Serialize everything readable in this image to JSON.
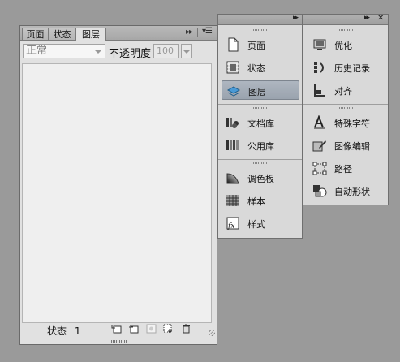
{
  "layers_panel": {
    "tabs": [
      {
        "label": "页面"
      },
      {
        "label": "状态"
      },
      {
        "label": "图层"
      }
    ],
    "menu_icon": "panel-menu-icon",
    "blend_mode": "正常",
    "opacity_label": "不透明度",
    "opacity_value": "100",
    "status_label": "状态",
    "status_count": "1"
  },
  "dock": {
    "left_column": {
      "group1": [
        {
          "label": "页面",
          "icon": "page-icon"
        },
        {
          "label": "状态",
          "icon": "states-icon"
        },
        {
          "label": "图层",
          "icon": "layers-icon"
        }
      ],
      "group2": [
        {
          "label": "文档库",
          "icon": "document-library-icon"
        },
        {
          "label": "公用库",
          "icon": "common-library-icon"
        }
      ],
      "group3": [
        {
          "label": "调色板",
          "icon": "color-palette-icon"
        },
        {
          "label": "样本",
          "icon": "swatches-icon"
        },
        {
          "label": "样式",
          "icon": "styles-icon"
        }
      ]
    },
    "right_column": {
      "group1": [
        {
          "label": "优化",
          "icon": "optimize-icon"
        },
        {
          "label": "历史记录",
          "icon": "history-icon"
        },
        {
          "label": "对齐",
          "icon": "align-icon"
        }
      ],
      "group2": [
        {
          "label": "特殊字符",
          "icon": "special-characters-icon"
        },
        {
          "label": "图像编辑",
          "icon": "image-editing-icon"
        },
        {
          "label": "路径",
          "icon": "path-icon"
        },
        {
          "label": "自动形状",
          "icon": "auto-shapes-icon"
        }
      ]
    }
  }
}
